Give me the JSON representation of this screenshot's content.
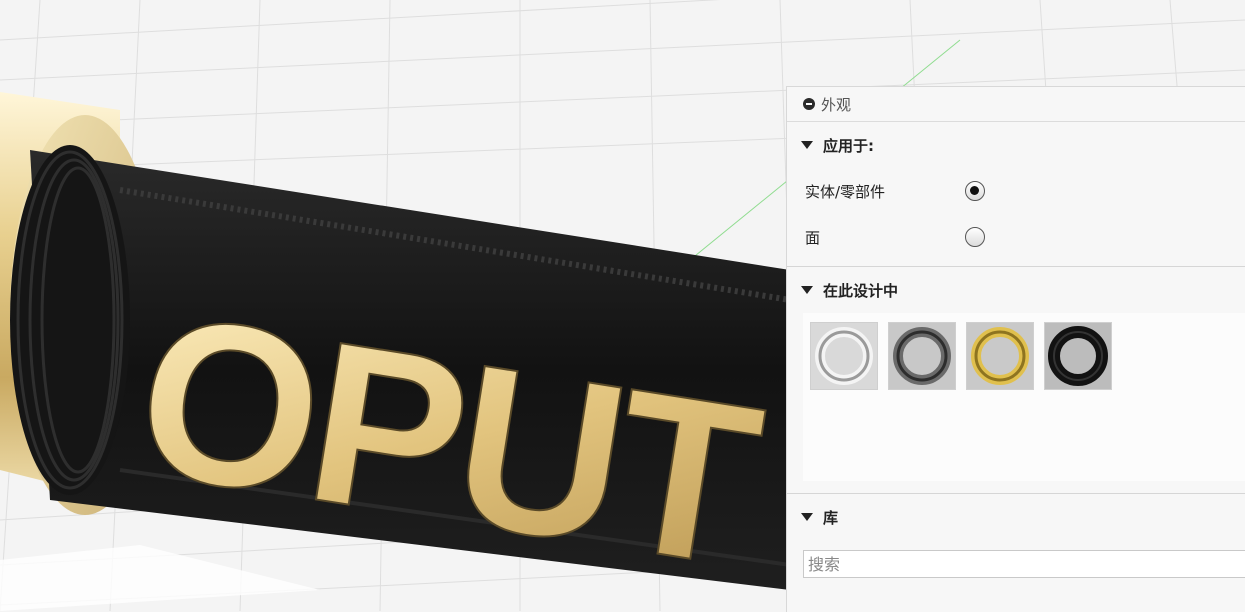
{
  "viewport": {
    "engraved_text": "OPUT",
    "colors": {
      "grid_bg": "#f4f4f4",
      "grid_line": "#d9d9d9",
      "rubber": "#151515",
      "gold": "#e6cc8a",
      "axis_green": "#7fd67f"
    }
  },
  "panel": {
    "title": "外观",
    "apply_to": {
      "label": "应用于:",
      "options": [
        {
          "label": "实体/零部件",
          "selected": true
        },
        {
          "label": "面",
          "selected": false
        }
      ]
    },
    "in_design": {
      "label": "在此设计中",
      "swatches": [
        {
          "name": "chrome-ring-swatch",
          "color": "#c8c8c8"
        },
        {
          "name": "dark-steel-ring-swatch",
          "color": "#6a6a6a"
        },
        {
          "name": "gold-ring-swatch",
          "color": "#d4b64a"
        },
        {
          "name": "black-rubber-ring-swatch",
          "color": "#1a1a1a"
        }
      ]
    },
    "library": {
      "label": "库",
      "search_placeholder": "搜索"
    }
  }
}
